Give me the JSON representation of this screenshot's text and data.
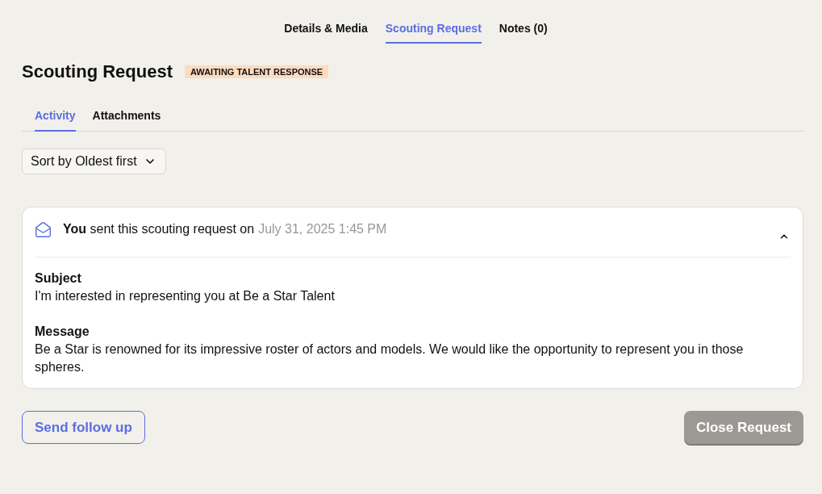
{
  "top_tabs": [
    {
      "label": "Details & Media",
      "selected": false
    },
    {
      "label": "Scouting Request",
      "selected": true
    },
    {
      "label": "Notes (0)",
      "selected": false
    }
  ],
  "header": {
    "title": "Scouting Request",
    "status_badge": "AWAITING TALENT RESPONSE"
  },
  "sub_tabs": [
    {
      "label": "Activity",
      "selected": true
    },
    {
      "label": "Attachments",
      "selected": false
    }
  ],
  "sort": {
    "value": "Sort by Oldest first"
  },
  "activity": [
    {
      "summary": "**You** sent this scouting request on",
      "timestamp": "July 31, 2025 1:45 PM",
      "expanded": true,
      "fields": [
        {
          "label": "Subject",
          "value": "I'm interested in representing you at Be a Star Talent"
        },
        {
          "label": "Message",
          "value": "Be a Star is renowned for its impressive roster of actors and models. We would like the opportunity to represent you in those spheres."
        }
      ]
    }
  ],
  "actions": [
    {
      "label": "Send follow up",
      "kind": "secondary",
      "disabled": false
    },
    {
      "label": "Close Request",
      "kind": "primary",
      "disabled": true
    }
  ]
}
